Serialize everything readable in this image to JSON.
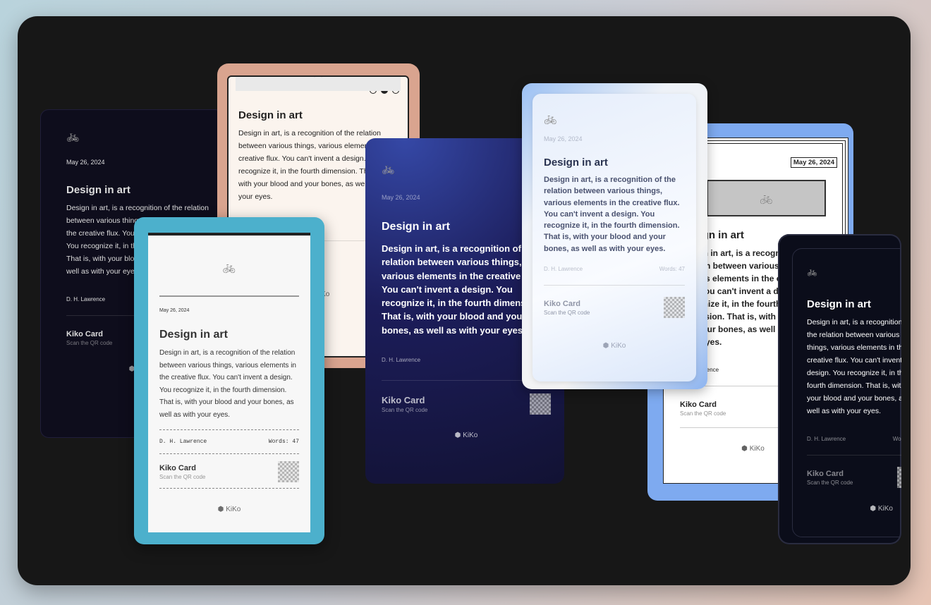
{
  "card": {
    "date": "May 26, 2024",
    "title": "Design in art",
    "body": "Design in art, is a recognition of the relation between various things, various elements in the creative flux. You can't invent a design. You recognize it, in the fourth dimension. That is, with your blood and your bones, as well as with your eyes.",
    "author": "D. H. Lawrence",
    "words": "Words: 47",
    "footer_title": "Kiko Card",
    "footer_subtitle": "Scan the QR code",
    "brand": "KiKo",
    "icon": "bicycle-icon"
  },
  "variants": [
    {
      "id": "k1",
      "name": "dark-card"
    },
    {
      "id": "k2",
      "name": "peach-card"
    },
    {
      "id": "k3",
      "name": "receipt-card"
    },
    {
      "id": "k4",
      "name": "navy-gradient-card"
    },
    {
      "id": "k5",
      "name": "blue-paper-stack-card"
    },
    {
      "id": "k6",
      "name": "glass-card"
    },
    {
      "id": "k7",
      "name": "black-card"
    }
  ]
}
